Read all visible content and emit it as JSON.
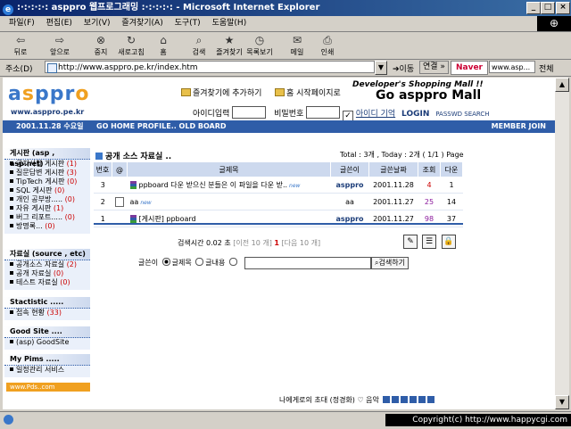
{
  "window": {
    "title": ":·:·:·:·: asppro 웹프로그래밍 :·:·:·:·: - Microsoft Internet Explorer"
  },
  "menu": [
    "파일(F)",
    "편집(E)",
    "보기(V)",
    "즐겨찾기(A)",
    "도구(T)",
    "도움말(H)"
  ],
  "toolbar": [
    "뒤로",
    "앞으로",
    "중지",
    "새로고침",
    "홈",
    "검색",
    "즐겨찾기",
    "목록보기",
    "메일",
    "인쇄"
  ],
  "address": {
    "label": "주소(D)",
    "url": "http://www.asppro.pe.kr/index.htm",
    "go": "이동",
    "links": "연결 »",
    "naver": "Naver",
    "search_placeholder": "www.asp...",
    "all": "전체"
  },
  "header": {
    "logo": "asppro",
    "logo_sub": "www.asppro.pe.kr",
    "fav_link": "즐겨찾기에 추가하기",
    "home_link": "홈 시작페이지로",
    "tagline": "Developer's Shopping Mall !!",
    "big_title": "Go asppro Mall",
    "id_label": "아이디입력",
    "pw_label": "비밀번호",
    "remember": "아이디 기억",
    "login": "LOGIN",
    "pw_search": "PASSWD SEARCH"
  },
  "nav": {
    "date": "2001.11.28 수요일",
    "links": "GO HOME  PROFILE..  OLD BOARD",
    "member": "MEMBER JOIN"
  },
  "sidebar": [
    {
      "title": "게시판 (asp , asp.net)",
      "items": [
        {
          "label": "공지사항 게시판",
          "count": "(1)"
        },
        {
          "label": "질문답변 게시판",
          "count": "(3)"
        },
        {
          "label": "TipTech 게시판",
          "count": "(0)"
        },
        {
          "label": "SQL 게시판",
          "count": "(0)"
        },
        {
          "label": "개인 공부방.....",
          "count": "(0)"
        },
        {
          "label": "자유 게시판",
          "count": "(1)"
        },
        {
          "label": "버그 리포트.....",
          "count": "(0)"
        },
        {
          "label": "방명록...",
          "count": "(0)"
        }
      ]
    },
    {
      "title": "자료실 (source , etc)",
      "items": [
        {
          "label": "공개소스 자료실",
          "count": "(2)"
        },
        {
          "label": "공개 자료실",
          "count": "(0)"
        },
        {
          "label": "테스트 자료실",
          "count": "(0)"
        }
      ]
    },
    {
      "title": "Stactistic .....",
      "items": [
        {
          "label": "접속 현황",
          "count": "(33)"
        }
      ]
    },
    {
      "title": "Good Site ....",
      "items": [
        {
          "label": "(asp) GoodSite",
          "count": ""
        }
      ]
    },
    {
      "title": "My Pims .....",
      "items": [
        {
          "label": "일정관리 서비스",
          "count": ""
        }
      ]
    }
  ],
  "banner": "www.Pds..com",
  "board": {
    "title": "공개 소스 자료실 ..",
    "stats": "Total : 3개 , Today : 2개   ( 1/1 ) Page",
    "columns": [
      "번호",
      "@",
      "글제목",
      "글쓴이",
      "글쓴날짜",
      "조회",
      "다운"
    ],
    "rows": [
      {
        "no": "3",
        "subject": "ppboard 다운 받으신 분들은 이 파일을 다운 받..",
        "new": "new",
        "author": "asppro",
        "date": "2001.11.28",
        "hits": "4",
        "down": "1"
      },
      {
        "no": "2",
        "subject": "aa",
        "new": "new",
        "author": "aa",
        "date": "2001.11.27",
        "hits": "25",
        "down": "14"
      },
      {
        "no": "1",
        "subject": "[게시판] ppboard",
        "new": "",
        "author": "asppro",
        "date": "2001.11.27",
        "hits": "98",
        "down": "37"
      }
    ],
    "search_time": "검색시간 0.02 초",
    "prev": "[이전 10 개]",
    "page": "1",
    "next": "[다음 10 개]",
    "search_by": "글쓴이",
    "opt_title": "글제목",
    "opt_content": "글내용",
    "search_btn": "검색하기"
  },
  "music": "나에게로의 초대 (정경화) ♡ 음악",
  "copyright": "Copyright(c) http://www.happycgi.com"
}
